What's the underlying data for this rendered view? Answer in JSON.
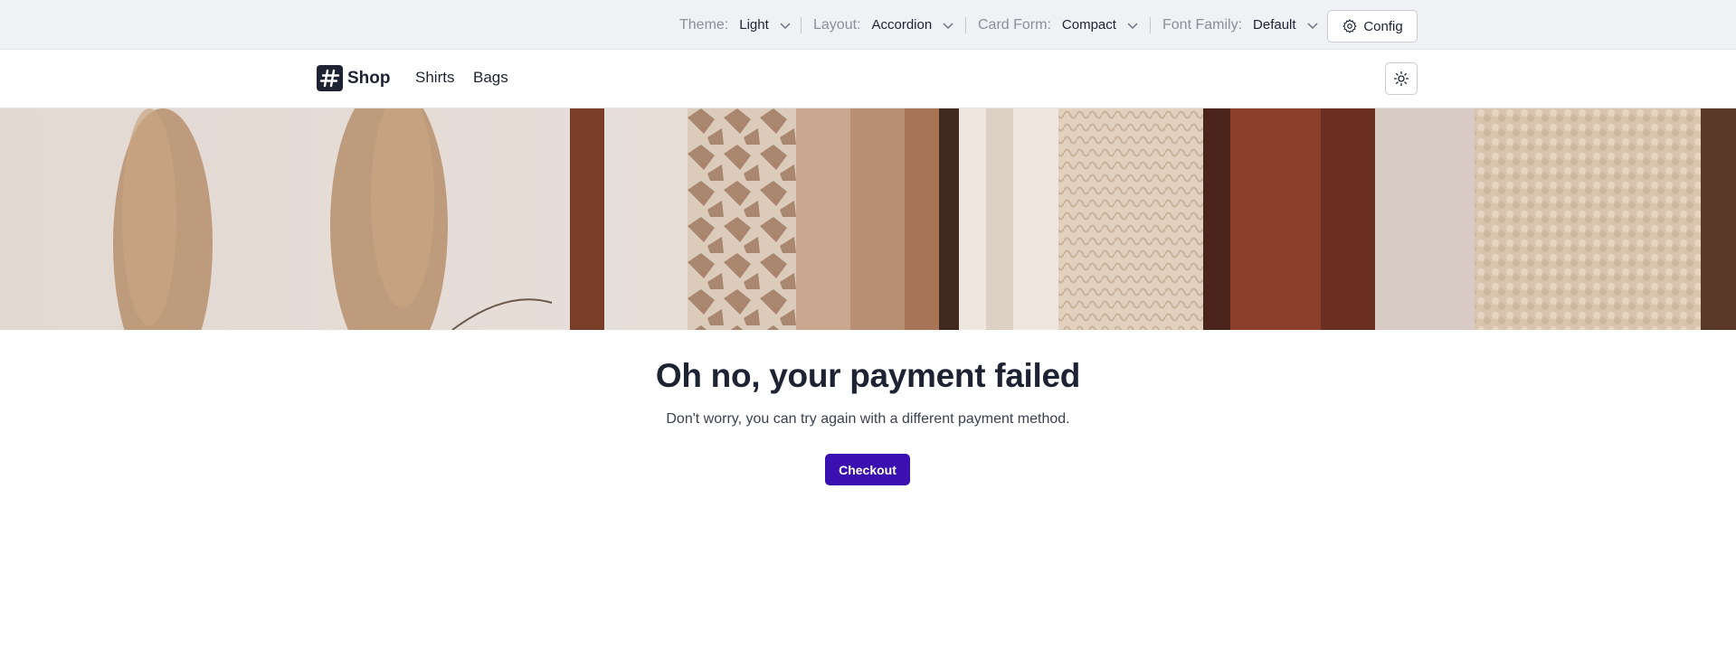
{
  "config_bar": {
    "theme": {
      "label": "Theme:",
      "value": "Light"
    },
    "layout": {
      "label": "Layout:",
      "value": "Accordion"
    },
    "card_form": {
      "label": "Card Form:",
      "value": "Compact"
    },
    "font_family": {
      "label": "Font Family:",
      "value": "Default"
    },
    "config_button_label": "Config"
  },
  "navbar": {
    "logo_text": "Shop",
    "links": [
      "Shirts",
      "Bags"
    ]
  },
  "hero": {
    "image_alt": "clothing rack with knit sweaters and pampas grass"
  },
  "main": {
    "headline": "Oh no, your payment failed",
    "subtext": "Don't worry, you can try again with a different payment method.",
    "checkout_label": "Checkout"
  },
  "colors": {
    "primary": "#3a10b0",
    "text": "#1e2333",
    "muted": "#8b8f99",
    "config_bg": "#f0f1f4"
  }
}
